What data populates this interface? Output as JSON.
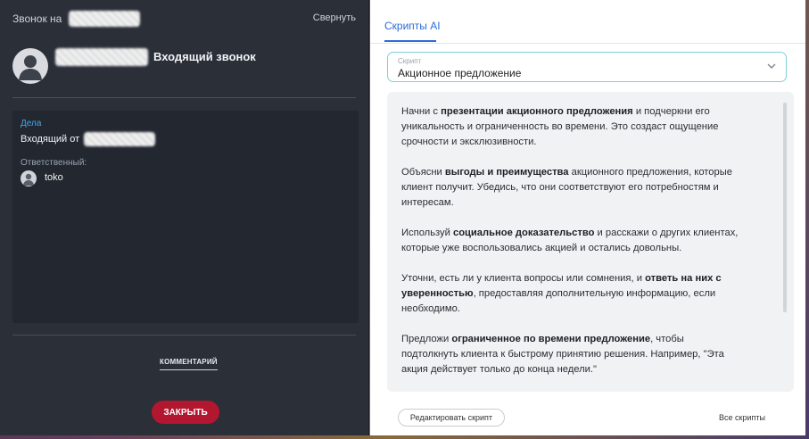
{
  "left_panel": {
    "call_title": "Звонок на",
    "collapse_label": "Свернуть",
    "caller_status": "Входящий звонок",
    "deal_label": "Дела",
    "incoming_from_label": "Входящий от",
    "responsible_label": "Ответственный:",
    "responsible_name": "toko",
    "comment_tab_label": "КОММЕНТАРИЙ",
    "close_button_label": "ЗАКРЫТЬ",
    "close_button_color": "#b2172f",
    "deal_label_color": "#45a7e6"
  },
  "right_panel": {
    "tab_label": "Скрипты AI",
    "accent_color": "#2b6dd6",
    "select": {
      "label": "Скрипт",
      "value": "Акционное предложение"
    },
    "edit_button_label": "Редактировать скрипт",
    "all_scripts_label": "Все скрипты",
    "paragraphs": [
      [
        {
          "text": "Начни с ",
          "bold": false
        },
        {
          "text": "презентации акционного предложения",
          "bold": true
        },
        {
          "text": " и подчеркни его уникальность и ограниченность во времени. Это создаст ощущение срочности и эксклюзивности.",
          "bold": false
        }
      ],
      [
        {
          "text": "Объясни ",
          "bold": false
        },
        {
          "text": "выгоды и преимущества",
          "bold": true
        },
        {
          "text": " акционного предложения, которые клиент получит. Убедись, что они соответствуют его потребностям и интересам.",
          "bold": false
        }
      ],
      [
        {
          "text": "Используй ",
          "bold": false
        },
        {
          "text": "социальное доказательство",
          "bold": true
        },
        {
          "text": " и расскажи о других клиентах, которые уже воспользовались акцией и остались довольны.",
          "bold": false
        }
      ],
      [
        {
          "text": "Уточни, есть ли у клиента вопросы или сомнения, и ",
          "bold": false
        },
        {
          "text": "ответь на них с уверенностью",
          "bold": true
        },
        {
          "text": ", предоставляя дополнительную информацию, если необходимо.",
          "bold": false
        }
      ],
      [
        {
          "text": "Предложи ",
          "bold": false
        },
        {
          "text": "ограниченное по времени предложение",
          "bold": true
        },
        {
          "text": ", чтобы подтолкнуть клиента к быстрому принятию решения. Например, \"Эта акция действует только до конца недели.\"",
          "bold": false
        }
      ]
    ]
  },
  "icons": {
    "caller_avatar": "person-avatar-icon",
    "responsible_avatar": "person-avatar-icon",
    "select_chevron": "chevron-down-icon"
  }
}
